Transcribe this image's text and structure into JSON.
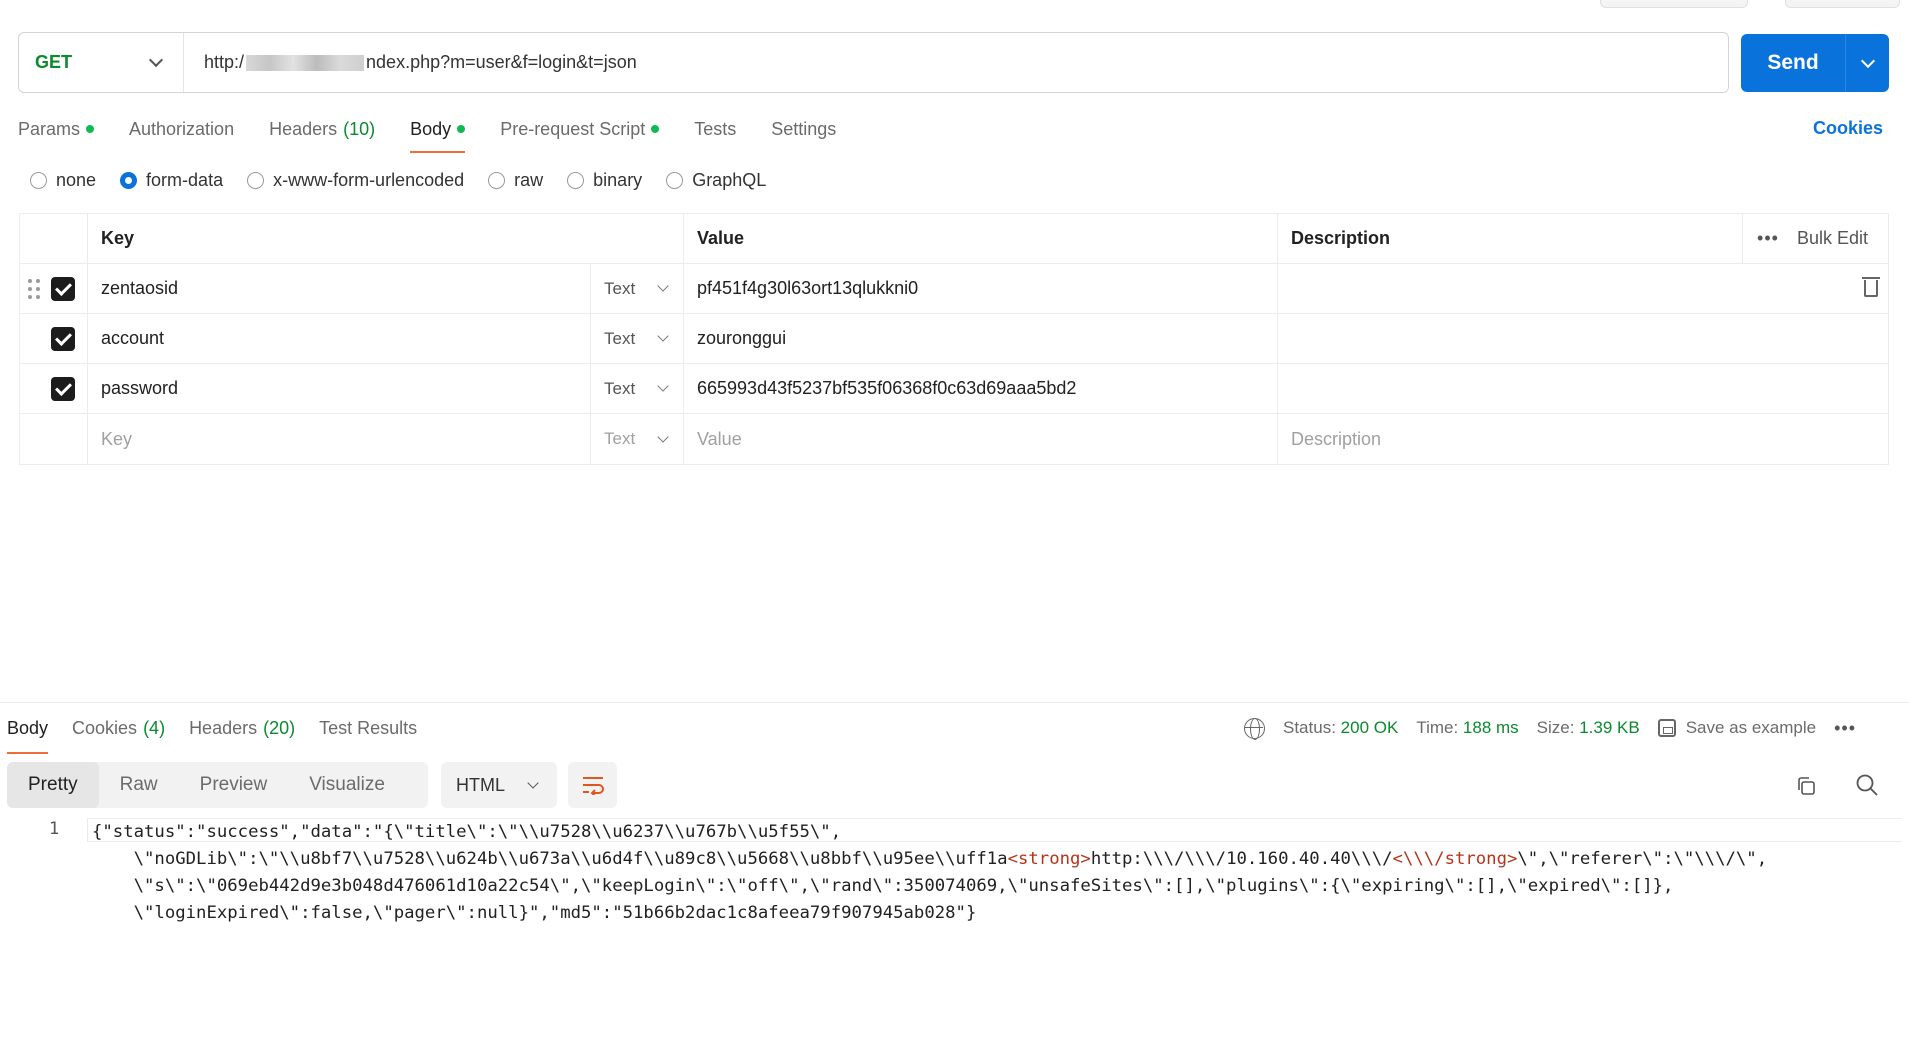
{
  "request": {
    "method": "GET",
    "url_prefix": "http:/",
    "url_suffix": "ndex.php?m=user&f=login&t=json",
    "send_label": "Send"
  },
  "request_tabs": {
    "params": "Params",
    "authorization": "Authorization",
    "headers": "Headers",
    "headers_count": "(10)",
    "body": "Body",
    "prerequest": "Pre-request Script",
    "tests": "Tests",
    "settings": "Settings",
    "cookies": "Cookies"
  },
  "body_types": {
    "none": "none",
    "form_data": "form-data",
    "urlencoded": "x-www-form-urlencoded",
    "raw": "raw",
    "binary": "binary",
    "graphql": "GraphQL",
    "selected": "form-data"
  },
  "form_table": {
    "headers": {
      "key": "Key",
      "value": "Value",
      "description": "Description",
      "bulk_edit": "Bulk Edit"
    },
    "rows": [
      {
        "key": "zentaosid",
        "type": "Text",
        "value": "pf451f4g30l63ort13qlukkni0",
        "description": ""
      },
      {
        "key": "account",
        "type": "Text",
        "value": "zouronggui",
        "description": ""
      },
      {
        "key": "password",
        "type": "Text",
        "value": "665993d43f5237bf535f06368f0c63d69aaa5bd2",
        "description": ""
      }
    ],
    "placeholder": {
      "key": "Key",
      "type": "Text",
      "value": "Value",
      "description": "Description"
    }
  },
  "response_tabs": {
    "body": "Body",
    "cookies": "Cookies",
    "cookies_count": "(4)",
    "headers": "Headers",
    "headers_count": "(20)",
    "test_results": "Test Results"
  },
  "response_meta": {
    "status_label": "Status:",
    "status": "200 OK",
    "time_label": "Time:",
    "time": "188 ms",
    "size_label": "Size:",
    "size": "1.39 KB",
    "save_example": "Save as example"
  },
  "response_view": {
    "modes": [
      "Pretty",
      "Raw",
      "Preview",
      "Visualize"
    ],
    "selected_mode": "Pretty",
    "language": "HTML"
  },
  "response_body": {
    "line_number": "1",
    "line1": "{\"status\":\"success\",\"data\":\"{\\\"title\\\":\\\"\\\\u7528\\\\u6237\\\\u767b\\\\u5f55\\\",",
    "line2a": "    \\\"noGDLib\\\":\\\"\\\\u8bf7\\\\u7528\\\\u624b\\\\u673a\\\\u6d4f\\\\u89c8\\\\u5668\\\\u8bbf\\\\u95ee\\\\uff1a",
    "line2_tag_open": "<strong>",
    "line2b": "http:\\\\\\/\\\\\\/10.160.40.40\\\\\\/",
    "line2_tag_close": "<\\\\\\/strong>",
    "line2c": "\\\",\\\"referer\\\":\\\"\\\\\\/\\\",",
    "line3": "    \\\"s\\\":\\\"069eb442d9e3b048d476061d10a22c54\\\",\\\"keepLogin\\\":\\\"off\\\",\\\"rand\\\":350074069,\\\"unsafeSites\\\":[],\\\"plugins\\\":{\\\"expiring\\\":[],\\\"expired\\\":[]},",
    "line4": "    \\\"loginExpired\\\":false,\\\"pager\\\":null}\",\"md5\":\"51b66b2dac1c8afeea79f907945ab028\"}"
  },
  "colors": {
    "accent": "#0a72db",
    "method_get": "#0b8a2e",
    "active_tab_underline": "#f26b3a",
    "status_dot": "#0cbb52"
  }
}
